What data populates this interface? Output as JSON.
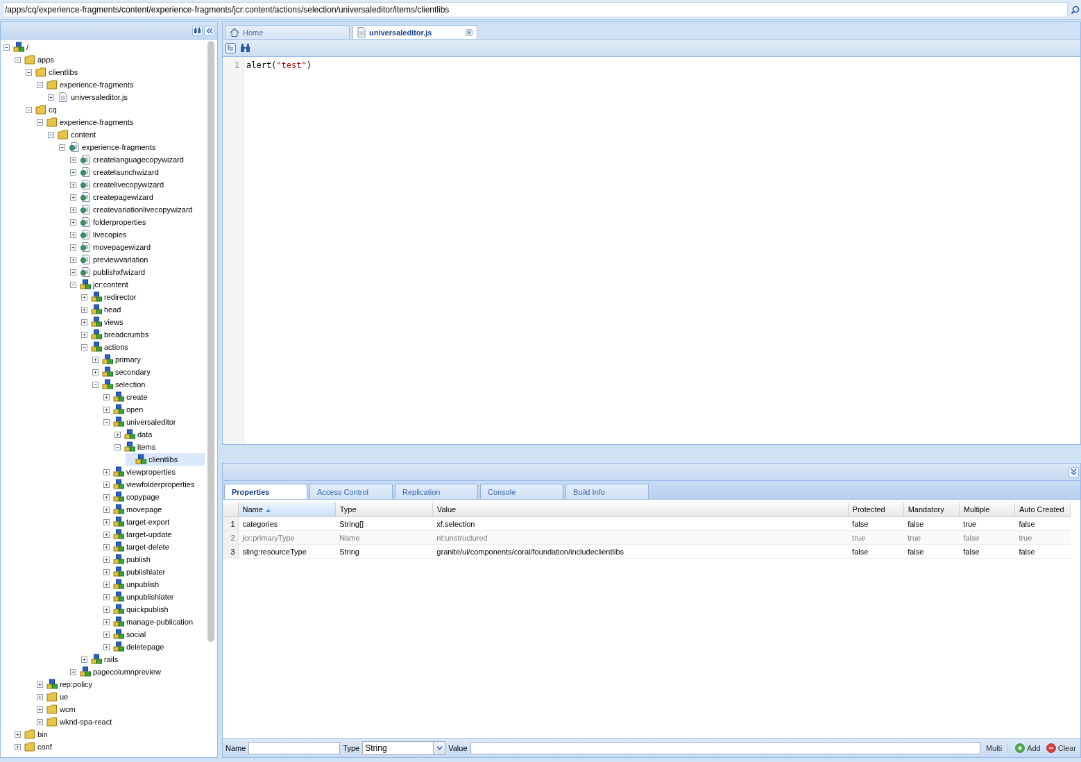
{
  "address_bar": {
    "value": "/apps/cq/experience-fragments/content/experience-fragments/jcr:content/actions/selection/universaleditor/items/clientlibs"
  },
  "tree": [
    {
      "label": "/",
      "kind": "node",
      "expanded": true,
      "selected": false,
      "children": [
        {
          "label": "apps",
          "kind": "folder",
          "expanded": true,
          "selected": false,
          "children": [
            {
              "label": "clientlibs",
              "kind": "folder",
              "expanded": true,
              "selected": false,
              "children": [
                {
                  "label": "experience-fragments",
                  "kind": "folder",
                  "expanded": true,
                  "selected": false,
                  "children": [
                    {
                      "label": "universaleditor.js",
                      "kind": "file",
                      "expanded": false,
                      "selected": false
                    }
                  ]
                }
              ]
            },
            {
              "label": "cq",
              "kind": "folder",
              "expanded": true,
              "selected": false,
              "children": [
                {
                  "label": "experience-fragments",
                  "kind": "folder",
                  "expanded": true,
                  "selected": false,
                  "children": [
                    {
                      "label": "content",
                      "kind": "folder",
                      "expanded": true,
                      "selected": false,
                      "children": [
                        {
                          "label": "experience-fragments",
                          "kind": "page",
                          "expanded": true,
                          "selected": false,
                          "children": [
                            {
                              "label": "createlanguagecopywizard",
                              "kind": "page",
                              "expanded": false,
                              "selected": false
                            },
                            {
                              "label": "createlaunchwizard",
                              "kind": "page",
                              "expanded": false,
                              "selected": false
                            },
                            {
                              "label": "createlivecopywizard",
                              "kind": "page",
                              "expanded": false,
                              "selected": false
                            },
                            {
                              "label": "createpagewizard",
                              "kind": "page",
                              "expanded": false,
                              "selected": false
                            },
                            {
                              "label": "createvariationlivecopywizard",
                              "kind": "page",
                              "expanded": false,
                              "selected": false
                            },
                            {
                              "label": "folderproperties",
                              "kind": "page",
                              "expanded": false,
                              "selected": false
                            },
                            {
                              "label": "livecopies",
                              "kind": "page",
                              "expanded": false,
                              "selected": false
                            },
                            {
                              "label": "movepagewizard",
                              "kind": "page",
                              "expanded": false,
                              "selected": false
                            },
                            {
                              "label": "previewvariation",
                              "kind": "page",
                              "expanded": false,
                              "selected": false
                            },
                            {
                              "label": "publishxfwizard",
                              "kind": "page",
                              "expanded": false,
                              "selected": false
                            },
                            {
                              "label": "jcr:content",
                              "kind": "node",
                              "expanded": true,
                              "selected": false,
                              "children": [
                                {
                                  "label": "redirector",
                                  "kind": "node",
                                  "expanded": false,
                                  "selected": false
                                },
                                {
                                  "label": "head",
                                  "kind": "node",
                                  "expanded": false,
                                  "selected": false
                                },
                                {
                                  "label": "views",
                                  "kind": "node",
                                  "expanded": false,
                                  "selected": false
                                },
                                {
                                  "label": "breadcrumbs",
                                  "kind": "node",
                                  "expanded": false,
                                  "selected": false
                                },
                                {
                                  "label": "actions",
                                  "kind": "node",
                                  "expanded": true,
                                  "selected": false,
                                  "children": [
                                    {
                                      "label": "primary",
                                      "kind": "node",
                                      "expanded": false,
                                      "selected": false
                                    },
                                    {
                                      "label": "secondary",
                                      "kind": "node",
                                      "expanded": false,
                                      "selected": false
                                    },
                                    {
                                      "label": "selection",
                                      "kind": "node",
                                      "expanded": true,
                                      "selected": false,
                                      "children": [
                                        {
                                          "label": "create",
                                          "kind": "node",
                                          "expanded": false,
                                          "selected": false
                                        },
                                        {
                                          "label": "open",
                                          "kind": "node",
                                          "expanded": false,
                                          "selected": false
                                        },
                                        {
                                          "label": "universaleditor",
                                          "kind": "node",
                                          "expanded": true,
                                          "selected": false,
                                          "children": [
                                            {
                                              "label": "data",
                                              "kind": "node",
                                              "expanded": false,
                                              "selected": false
                                            },
                                            {
                                              "label": "items",
                                              "kind": "node",
                                              "expanded": true,
                                              "selected": false,
                                              "children": [
                                                {
                                                  "label": "clientlibs",
                                                  "kind": "node",
                                                  "selected": true
                                                }
                                              ]
                                            }
                                          ]
                                        },
                                        {
                                          "label": "viewproperties",
                                          "kind": "node",
                                          "expanded": false,
                                          "selected": false
                                        },
                                        {
                                          "label": "viewfolderproperties",
                                          "kind": "node",
                                          "expanded": false,
                                          "selected": false
                                        },
                                        {
                                          "label": "copypage",
                                          "kind": "node",
                                          "expanded": false,
                                          "selected": false
                                        },
                                        {
                                          "label": "movepage",
                                          "kind": "node",
                                          "expanded": false,
                                          "selected": false
                                        },
                                        {
                                          "label": "target-export",
                                          "kind": "node",
                                          "expanded": false,
                                          "selected": false
                                        },
                                        {
                                          "label": "target-update",
                                          "kind": "node",
                                          "expanded": false,
                                          "selected": false
                                        },
                                        {
                                          "label": "target-delete",
                                          "kind": "node",
                                          "expanded": false,
                                          "selected": false
                                        },
                                        {
                                          "label": "publish",
                                          "kind": "node",
                                          "expanded": false,
                                          "selected": false
                                        },
                                        {
                                          "label": "publishlater",
                                          "kind": "node",
                                          "expanded": false,
                                          "selected": false
                                        },
                                        {
                                          "label": "unpublish",
                                          "kind": "node",
                                          "expanded": false,
                                          "selected": false
                                        },
                                        {
                                          "label": "unpublishlater",
                                          "kind": "node",
                                          "expanded": false,
                                          "selected": false
                                        },
                                        {
                                          "label": "quickpublish",
                                          "kind": "node",
                                          "expanded": false,
                                          "selected": false
                                        },
                                        {
                                          "label": "manage-publication",
                                          "kind": "node",
                                          "expanded": false,
                                          "selected": false
                                        },
                                        {
                                          "label": "social",
                                          "kind": "node",
                                          "expanded": false,
                                          "selected": false
                                        },
                                        {
                                          "label": "deletepage",
                                          "kind": "node",
                                          "expanded": false,
                                          "selected": false
                                        }
                                      ]
                                    }
                                  ]
                                },
                                {
                                  "label": "rails",
                                  "kind": "node",
                                  "expanded": false,
                                  "selected": false
                                }
                              ]
                            },
                            {
                              "label": "pagecolumnpreview",
                              "kind": "node",
                              "expanded": false,
                              "selected": false
                            }
                          ]
                        }
                      ]
                    }
                  ]
                },
                {
                  "label": "rep:policy",
                  "kind": "node",
                  "expanded": false,
                  "selected": false
                },
                {
                  "label": "ue",
                  "kind": "folder",
                  "expanded": false,
                  "selected": false
                },
                {
                  "label": "wcm",
                  "kind": "folder",
                  "expanded": false,
                  "selected": false
                },
                {
                  "label": "wknd-spa-react",
                  "kind": "folder",
                  "expanded": false,
                  "selected": false
                }
              ]
            }
          ]
        },
        {
          "label": "bin",
          "kind": "folder",
          "expanded": false,
          "selected": false
        },
        {
          "label": "conf",
          "kind": "folder",
          "expanded": false,
          "selected": false
        }
      ]
    }
  ],
  "editor_tabs": [
    {
      "label": "Home",
      "kind": "home",
      "selected": false
    },
    {
      "label": "universaleditor.js",
      "kind": "file",
      "selected": true
    }
  ],
  "editor": {
    "lines": [
      {
        "number": "1",
        "code": "alert(",
        "string": "\"test\"",
        "rest": ")"
      }
    ]
  },
  "property_tabs": [
    {
      "label": "Properties",
      "selected": true
    },
    {
      "label": "Access Control",
      "selected": false
    },
    {
      "label": "Replication",
      "selected": false
    },
    {
      "label": "Console",
      "selected": false
    },
    {
      "label": "Build Info",
      "selected": false
    }
  ],
  "properties": {
    "columns": [
      {
        "label": "Name",
        "sorted": true
      },
      {
        "label": "Type",
        "sorted": false
      },
      {
        "label": "Value",
        "sorted": false
      },
      {
        "label": "Protected",
        "sorted": false
      },
      {
        "label": "Mandatory",
        "sorted": false
      },
      {
        "label": "Multiple",
        "sorted": false
      },
      {
        "label": "Auto Created",
        "sorted": false
      }
    ],
    "rows": [
      {
        "number": "1",
        "disabled": false,
        "cells": [
          "categories",
          "String[]",
          "xf.selection",
          "false",
          "false",
          "true",
          "false"
        ]
      },
      {
        "number": "2",
        "disabled": true,
        "cells": [
          "jcr:primaryType",
          "Name",
          "nt:unstructured",
          "true",
          "true",
          "false",
          "true"
        ]
      },
      {
        "number": "3",
        "disabled": false,
        "cells": [
          "sling:resourceType",
          "String",
          "granite/ui/components/coral/foundation/includeclientlibs",
          "false",
          "false",
          "false",
          "false"
        ]
      }
    ]
  },
  "add_bar": {
    "name_label": "Name",
    "type_label": "Type",
    "type_value": "String",
    "value_label": "Value",
    "multi_label": "Multi",
    "add_button": "Add",
    "clear_button": "Clear"
  }
}
